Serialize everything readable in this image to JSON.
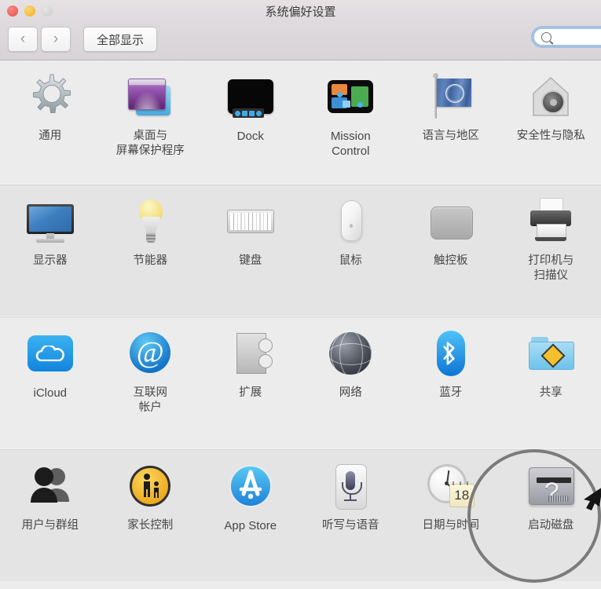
{
  "window": {
    "title": "系统偏好设置",
    "traffic_lights": [
      {
        "name": "close",
        "color": "#ec5f5a"
      },
      {
        "name": "minimize",
        "color": "#f4bb39"
      },
      {
        "name": "zoom",
        "color": "#d3d3d3"
      }
    ]
  },
  "toolbar": {
    "back_label": "‹",
    "forward_label": "›",
    "show_all_label": "全部显示",
    "search_placeholder": "",
    "search_value": ""
  },
  "rows": [
    {
      "shaded": false,
      "items": [
        {
          "label": "通用",
          "icon": "gear-icon",
          "latin": false
        },
        {
          "label": "桌面与\n屏幕保护程序",
          "icon": "desktop-screensaver-icon",
          "latin": false
        },
        {
          "label": "Dock",
          "icon": "dock-icon",
          "latin": true
        },
        {
          "label": "Mission\nControl",
          "icon": "mission-control-icon",
          "latin": true
        },
        {
          "label": "语言与地区",
          "icon": "language-region-flag-icon",
          "latin": false
        },
        {
          "label": "安全性与隐私",
          "icon": "security-privacy-icon",
          "latin": false
        }
      ]
    },
    {
      "shaded": true,
      "items": [
        {
          "label": "显示器",
          "icon": "display-icon",
          "latin": false
        },
        {
          "label": "节能器",
          "icon": "energy-saver-bulb-icon",
          "latin": false
        },
        {
          "label": "键盘",
          "icon": "keyboard-icon",
          "latin": false
        },
        {
          "label": "鼠标",
          "icon": "mouse-icon",
          "latin": false
        },
        {
          "label": "触控板",
          "icon": "trackpad-icon",
          "latin": false
        },
        {
          "label": "打印机与\n扫描仪",
          "icon": "printer-scanner-icon",
          "latin": false
        }
      ]
    },
    {
      "shaded": false,
      "items": [
        {
          "label": "iCloud",
          "icon": "icloud-icon",
          "latin": true
        },
        {
          "label": "互联网\n帐户",
          "icon": "internet-accounts-at-icon",
          "latin": false
        },
        {
          "label": "扩展",
          "icon": "extensions-puzzle-icon",
          "latin": false
        },
        {
          "label": "网络",
          "icon": "network-globe-icon",
          "latin": false
        },
        {
          "label": "蓝牙",
          "icon": "bluetooth-icon",
          "latin": false
        },
        {
          "label": "共享",
          "icon": "sharing-folder-icon",
          "latin": false
        }
      ]
    },
    {
      "shaded": true,
      "items": [
        {
          "label": "用户与群组",
          "icon": "users-groups-icon",
          "latin": false
        },
        {
          "label": "家长控制",
          "icon": "parental-controls-icon",
          "latin": false
        },
        {
          "label": "App Store",
          "icon": "app-store-icon",
          "latin": true
        },
        {
          "label": "听写与语音",
          "icon": "dictation-speech-mic-icon",
          "latin": false
        },
        {
          "label": "日期与时间",
          "icon": "date-time-clock-icon",
          "latin": false
        },
        {
          "label": "启动磁盘",
          "icon": "startup-disk-icon",
          "latin": false
        }
      ]
    }
  ],
  "date_time_icon": {
    "calendar_day": "18"
  },
  "internet_accounts_icon": {
    "glyph": "@"
  },
  "startup_disk_icon": {
    "glyph": "?"
  },
  "annotation": {
    "highlight_target": "启动磁盘",
    "circle_color": "#7b7b7b",
    "arrow_color": "#1a1a1a"
  }
}
